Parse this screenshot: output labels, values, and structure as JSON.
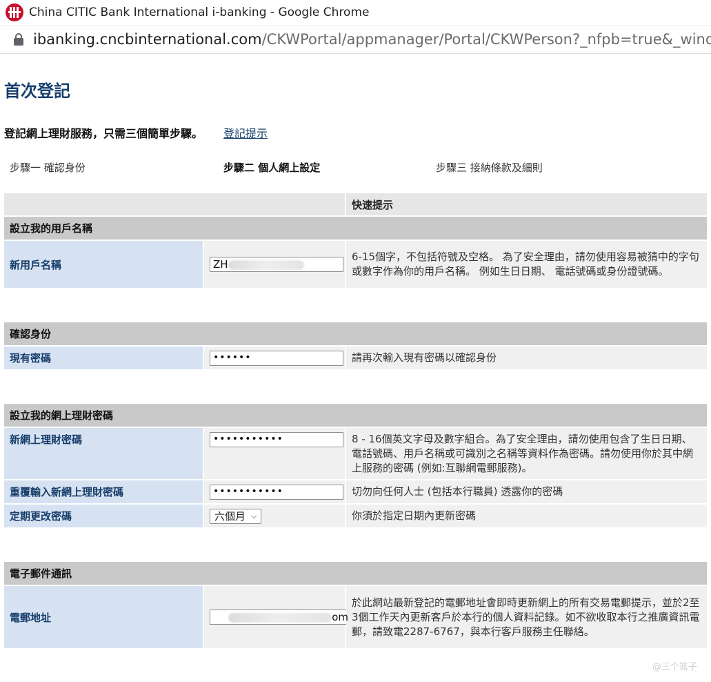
{
  "browser": {
    "window_title": "China CITIC Bank International i-banking - Google Chrome",
    "url_host": "ibanking.cncbinternational.com",
    "url_path": "/CKWPortal/appmanager/Portal/CKWPerson?_nfpb=true&_window"
  },
  "page": {
    "title": "首次登記",
    "intro": "登記網上理財服務，只需三個簡單步驟。",
    "help_link": "登記提示",
    "steps": [
      "步驟一 確認身份",
      "步驟二 個人網上設定",
      "步驟三 接納條款及細則"
    ]
  },
  "form": {
    "tips_header": "快速提示",
    "sections": {
      "username": {
        "title": "設立我的用戶名稱",
        "label": "新用戶名稱",
        "value": "ZH",
        "tip": "6-15個字，不包括符號及空格。 為了安全理由，請勿使用容易被猜中的字句或數字作為你的用戶名稱。 例如生日日期、 電話號碼或身份證號碼。"
      },
      "identity": {
        "title": "確認身份",
        "label": "現有密碼",
        "value": "••••••",
        "tip": "請再次輸入現有密碼以確認身份"
      },
      "password": {
        "title": "設立我的網上理財密碼",
        "new_label": "新網上理財密碼",
        "new_value": "•••••••••••",
        "new_tip": "8 - 16個英文字母及數字組合。為了安全理由，請勿使用包含了生日日期、電話號碼、用戶名稱或可識別之名稱等資料作為密碼。請勿使用你於其中網上服務的密碼 (例如:互聯網電郵服務)。",
        "confirm_label": "重覆輸入新網上理財密碼",
        "confirm_value": "•••••••••••",
        "confirm_tip": "切勿向任何人士 (包括本行職員) 透露你的密碼",
        "period_label": "定期更改密碼",
        "period_value": "六個月",
        "period_tip": "你須於指定日期內更新密碼"
      },
      "email": {
        "title": "電子郵件通訊",
        "label": "電郵地址",
        "value": "om",
        "tip": "於此網站最新登記的電郵地址會即時更新網上的所有交易電郵提示，並於2至3個工作天內更新客戶於本行的個人資料記錄。如不欲收取本行之推廣資訊電郵，請致電2287-6767，與本行客戶服務主任聯絡。"
      }
    }
  },
  "watermark": "@三个篮子"
}
